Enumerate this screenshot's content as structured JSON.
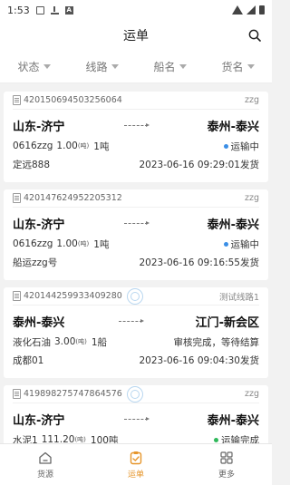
{
  "status_bar": {
    "time": "1:53"
  },
  "header": {
    "title": "运单"
  },
  "filters": [
    {
      "label": "状态"
    },
    {
      "label": "线路"
    },
    {
      "label": "船名"
    },
    {
      "label": "货名"
    }
  ],
  "waybills": [
    {
      "number": "420150694503256064",
      "route_tag": "zzg",
      "from": "山东-济宁",
      "to": "泰州-泰兴",
      "goods": "0616zzg",
      "amount": "1.00",
      "amount_unit": "(吨)",
      "trips": "1吨",
      "status": "运输中",
      "status_color": "#3a8ee6",
      "ship": "定远888",
      "time": "2023-06-16 09:29:01发货"
    },
    {
      "number": "420147624952205312",
      "route_tag": "zzg",
      "from": "山东-济宁",
      "to": "泰州-泰兴",
      "goods": "0616zzg",
      "amount": "1.00",
      "amount_unit": "(吨)",
      "trips": "1吨",
      "status": "运输中",
      "status_color": "#3a8ee6",
      "ship": "船运zzg号",
      "time": "2023-06-16 09:16:55发货"
    },
    {
      "number": "420144259933409280",
      "route_tag": "测试线路1",
      "from": "泰州-泰兴",
      "to": "江门-新会区",
      "goods": "液化石油",
      "amount": "3.00",
      "amount_unit": "(吨)",
      "trips": "1船",
      "status": "审核完成，等待结算",
      "status_color": "",
      "ship": "成都01",
      "time": "2023-06-16 09:04:30发货"
    },
    {
      "number": "419898275747864576",
      "route_tag": "zzg",
      "from": "山东-济宁",
      "to": "泰州-泰兴",
      "goods": "水泥1",
      "amount": "111.20",
      "amount_unit": "(吨)",
      "trips": "100吨",
      "status": "运输完成",
      "status_color": "#2fb85a",
      "ship": "",
      "time": ""
    }
  ],
  "tabbar": [
    {
      "label": "货源"
    },
    {
      "label": "运单"
    },
    {
      "label": "更多"
    }
  ],
  "colors": {
    "accent": "#e6952a",
    "in_transit": "#3a8ee6",
    "done": "#2fb85a"
  }
}
